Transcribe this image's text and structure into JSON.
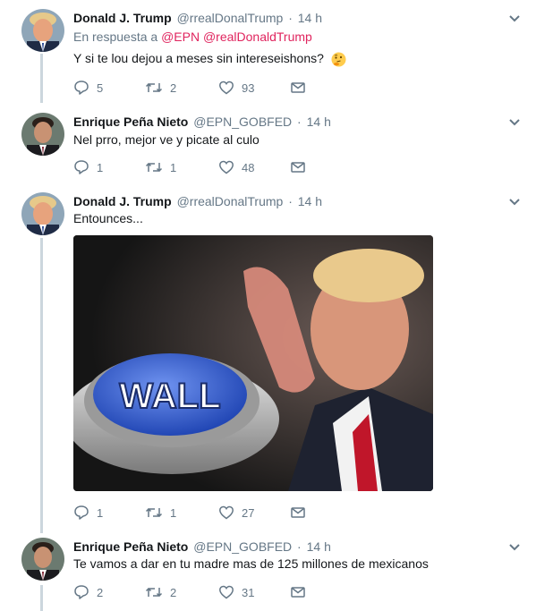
{
  "tweets": [
    {
      "name": "Donald J. Trump",
      "handle": "@rrealDonalTrump",
      "time": "14 h",
      "reply_prefix": "En respuesta a",
      "reply_mention_1": "@EPN",
      "reply_mention_2": "@realDonaldTrump",
      "text": "Y si te lou dejou a meses sin intereseishons?",
      "emoji": "thinking-face",
      "replies": "5",
      "retweets": "2",
      "likes": "93"
    },
    {
      "name": "Enrique Peña Nieto",
      "handle": "@EPN_GOBFED",
      "time": "14 h",
      "text": "Nel prro, mejor ve y picate al culo",
      "replies": "1",
      "retweets": "1",
      "likes": "48"
    },
    {
      "name": "Donald J. Trump",
      "handle": "@rrealDonalTrump",
      "time": "14 h",
      "text": "Entounces...",
      "media": {
        "button_label": "WALL"
      },
      "replies": "1",
      "retweets": "1",
      "likes": "27"
    },
    {
      "name": "Enrique Peña Nieto",
      "handle": "@EPN_GOBFED",
      "time": "14 h",
      "text": "Te vamos a dar en tu madre mas de 125 millones de mexicanos",
      "replies": "2",
      "retweets": "2",
      "likes": "31"
    }
  ],
  "dot": "·",
  "icons": [
    "reply-icon",
    "retweet-icon",
    "like-icon",
    "direct-message-icon",
    "chevron-down-icon"
  ],
  "colors": {
    "secondary_text": "#657786",
    "mention": "#e0245e",
    "thread_line": "#ccd6dd",
    "wall_button": "#3b63d8"
  }
}
